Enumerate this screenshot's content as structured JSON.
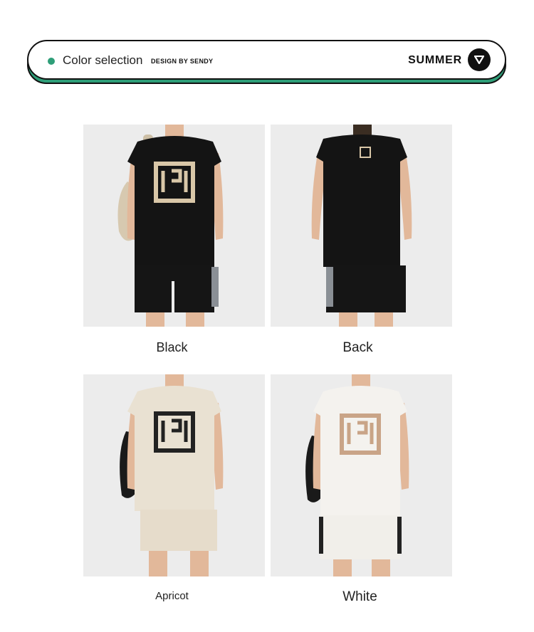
{
  "banner": {
    "title": "Color selection",
    "design_tag": "DESIGN BY SENDY",
    "season": "SUMMER",
    "accent_color": "#2e9e78",
    "button_icon": "triangle-down-icon"
  },
  "products": [
    {
      "caption": "Black",
      "shirt_color": "#141414",
      "print_color": "#d9c7a8"
    },
    {
      "caption": "Back",
      "shirt_color": "#141414",
      "print_color": "#d9c7a8"
    },
    {
      "caption": "Apricot",
      "shirt_color": "#e9e1d2",
      "print_color": "#222222"
    },
    {
      "caption": "White",
      "shirt_color": "#f4f2ee",
      "print_color": "#c9a487"
    }
  ]
}
